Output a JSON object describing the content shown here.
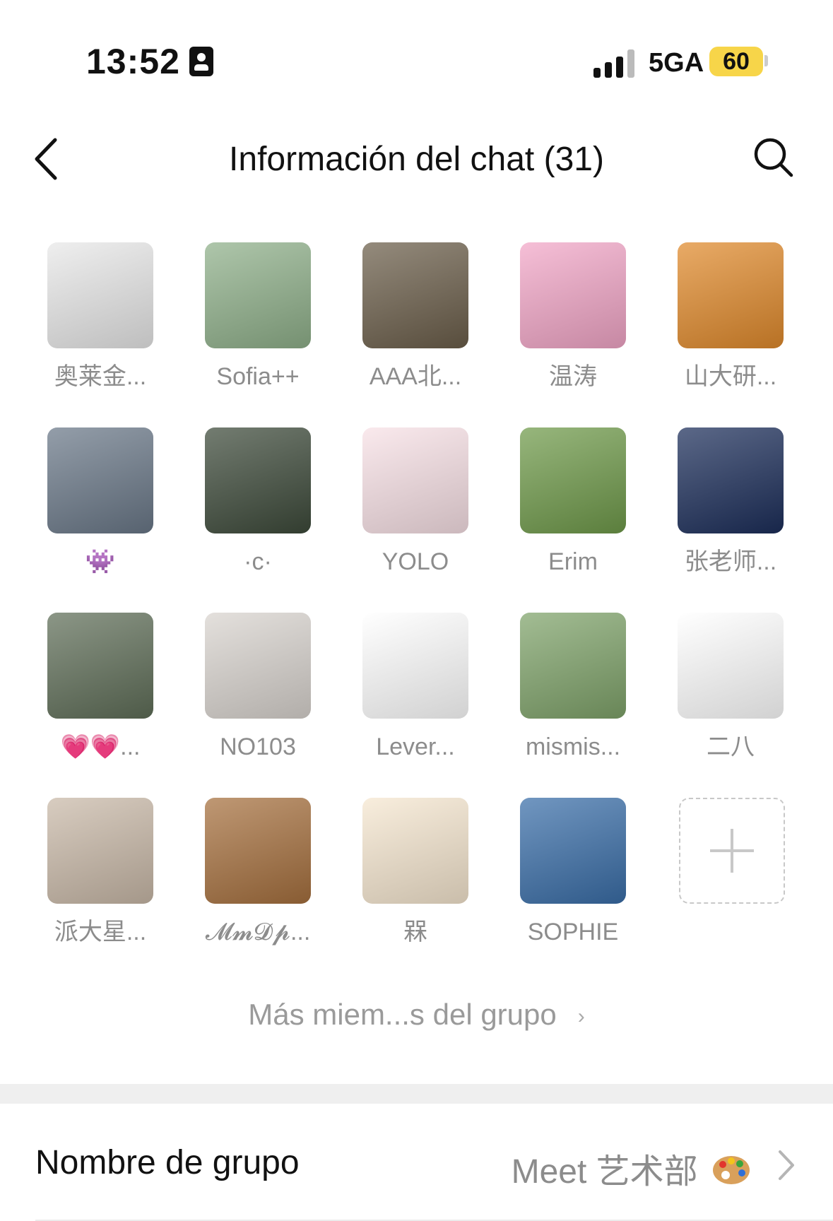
{
  "status_bar": {
    "time": "13:52",
    "network": "5GA",
    "battery": "60"
  },
  "header": {
    "title": "Información del chat (31)"
  },
  "members": [
    {
      "name": "奥莱金...",
      "icon": "pig-crown-avatar",
      "color": "#e8e8e8"
    },
    {
      "name": "Sofia++",
      "icon": "photo-avatar",
      "color": "#8fb08a"
    },
    {
      "name": "AAA北...",
      "icon": "dog-avatar",
      "color": "#6b5e4a"
    },
    {
      "name": "温涛",
      "icon": "cat-guitar-avatar",
      "color": "#f2a6c7"
    },
    {
      "name": "山大研...",
      "icon": "monkey-avatar",
      "color": "#e08a2c"
    },
    {
      "name": "👾",
      "icon": "sonic-avatar",
      "color": "#6a7888"
    },
    {
      "name": "·c·",
      "icon": "rabbit-avatar",
      "color": "#3d4a3a"
    },
    {
      "name": "YOLO",
      "icon": "cartoon-dog-avatar",
      "color": "#f8e1e6"
    },
    {
      "name": "Erim",
      "icon": "photo-avatar",
      "color": "#6f9a4a"
    },
    {
      "name": "张老师...",
      "icon": "rocket-avatar",
      "color": "#1c2e5a"
    },
    {
      "name": "💗💗...",
      "icon": "photo-avatar",
      "color": "#5f6e58"
    },
    {
      "name": "NO103",
      "icon": "headphones-avatar",
      "color": "#d9d4cf"
    },
    {
      "name": "Lever...",
      "icon": "text-avatar",
      "color": "#ffffff"
    },
    {
      "name": "mismis...",
      "icon": "photo-avatar",
      "color": "#7fa36a"
    },
    {
      "name": "二八",
      "icon": "duck-avatar",
      "color": "#ffffff"
    },
    {
      "name": "派大星...",
      "icon": "mask-avatar",
      "color": "#c9b9a8"
    },
    {
      "name": "𝓜𝓶𝓓𝓹...",
      "icon": "reading-avatar",
      "color": "#a6703e"
    },
    {
      "name": "槑",
      "icon": "cat-avatar",
      "color": "#f6e7d0"
    },
    {
      "name": "SOPHIE",
      "icon": "illustration-avatar",
      "color": "#3a6ea8"
    }
  ],
  "add_member_icon": "plus-icon",
  "more_members": {
    "label": "Más miem...s del grupo"
  },
  "settings": {
    "group_name_label": "Nombre de grupo",
    "group_name_value": "Meet 艺术部"
  },
  "colors": {
    "battery": "#f7d549",
    "muted_text": "#8c8c8c",
    "separator": "#efefef"
  }
}
